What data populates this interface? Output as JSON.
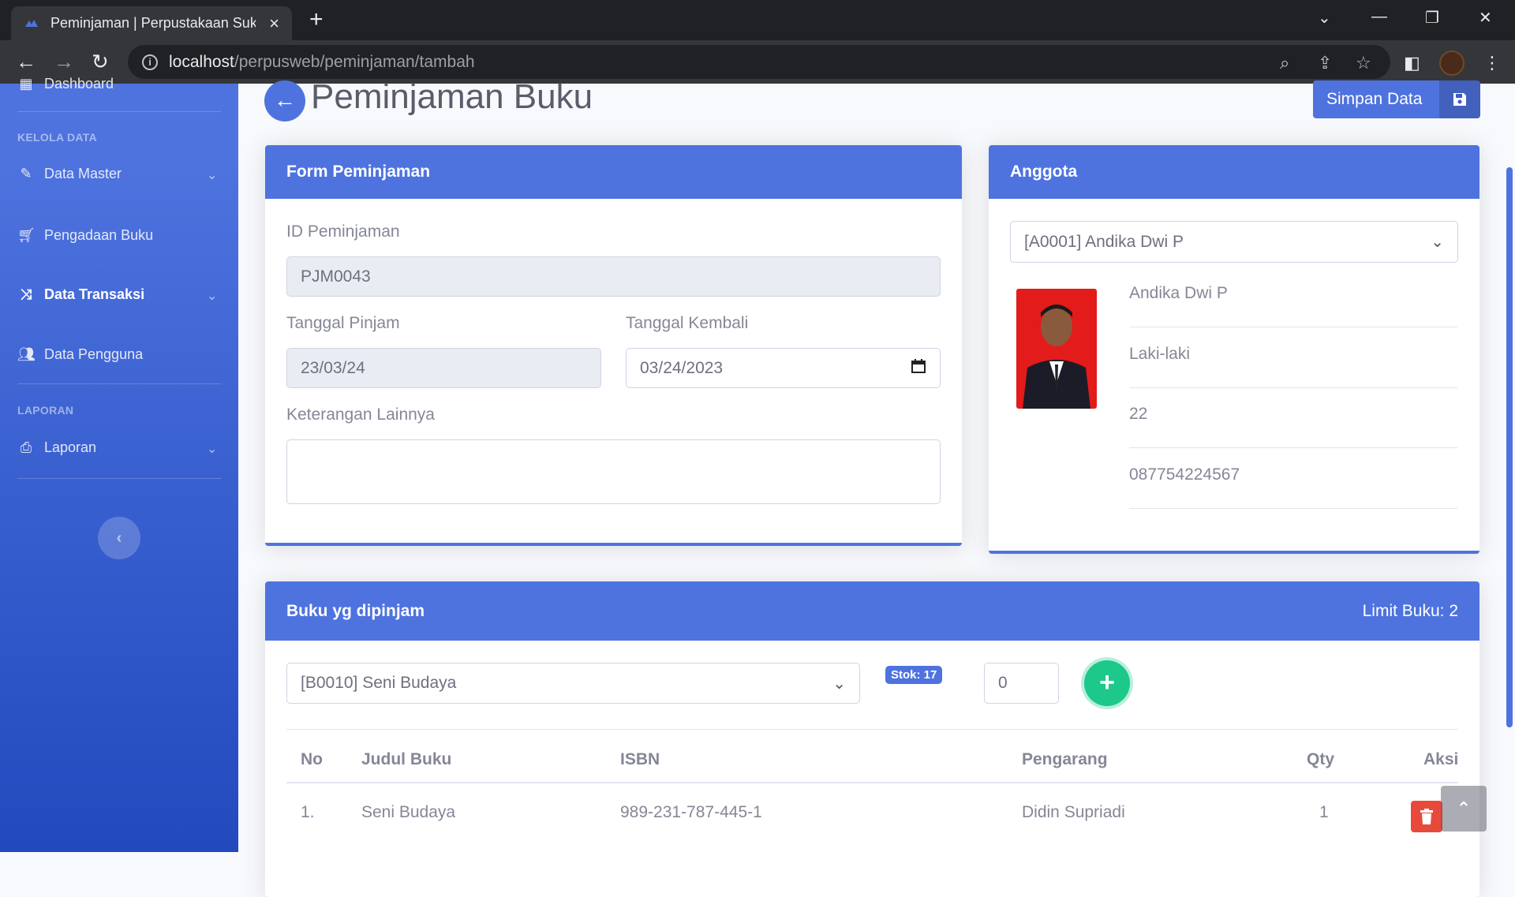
{
  "browser": {
    "tab_title": "Peminjaman | Perpustakaan Suka",
    "url_host": "localhost",
    "url_path": "/perpusweb/peminjaman/tambah"
  },
  "sidebar": {
    "top_item": "Dashboard",
    "heading_kelola": "KELOLA DATA",
    "items": [
      {
        "label": "Data Master",
        "icon": "edit-icon",
        "has_chevron": true
      },
      {
        "label": "Pengadaan Buku",
        "icon": "cart-icon",
        "has_chevron": false
      },
      {
        "label": "Data Transaksi",
        "icon": "shuffle-icon",
        "has_chevron": true,
        "active": true
      },
      {
        "label": "Data Pengguna",
        "icon": "users-icon",
        "has_chevron": false
      }
    ],
    "heading_laporan": "LAPORAN",
    "laporan": {
      "label": "Laporan",
      "icon": "print-icon"
    }
  },
  "header": {
    "title": "Peminjaman Buku",
    "save_label": "Simpan Data"
  },
  "form": {
    "title": "Form Peminjaman",
    "id_label": "ID Peminjaman",
    "id_value": "PJM0043",
    "tgl_pinjam_label": "Tanggal Pinjam",
    "tgl_pinjam_value": "23/03/24",
    "tgl_kembali_label": "Tanggal Kembali",
    "tgl_kembali_value": "03/24/2023",
    "keterangan_label": "Keterangan Lainnya",
    "keterangan_value": ""
  },
  "anggota": {
    "title": "Anggota",
    "selected": "[A0001] Andika Dwi P",
    "name": "Andika Dwi P",
    "gender": "Laki-laki",
    "age": "22",
    "phone": "087754224567"
  },
  "buku": {
    "title": "Buku yg dipinjam",
    "limit_label": "Limit Buku: 2",
    "selected_book": "[B0010] Seni Budaya",
    "stok_badge": "Stok: 17",
    "qty_input": "0",
    "columns": [
      "No",
      "Judul Buku",
      "ISBN",
      "Pengarang",
      "Qty",
      "Aksi"
    ],
    "rows": [
      {
        "no": "1.",
        "judul": "Seni Budaya",
        "isbn": "989-231-787-445-1",
        "pengarang": "Didin Supriadi",
        "qty": "1"
      }
    ]
  },
  "colors": {
    "primary": "#4e73df",
    "success": "#1cc88a",
    "danger": "#e74a3b"
  }
}
